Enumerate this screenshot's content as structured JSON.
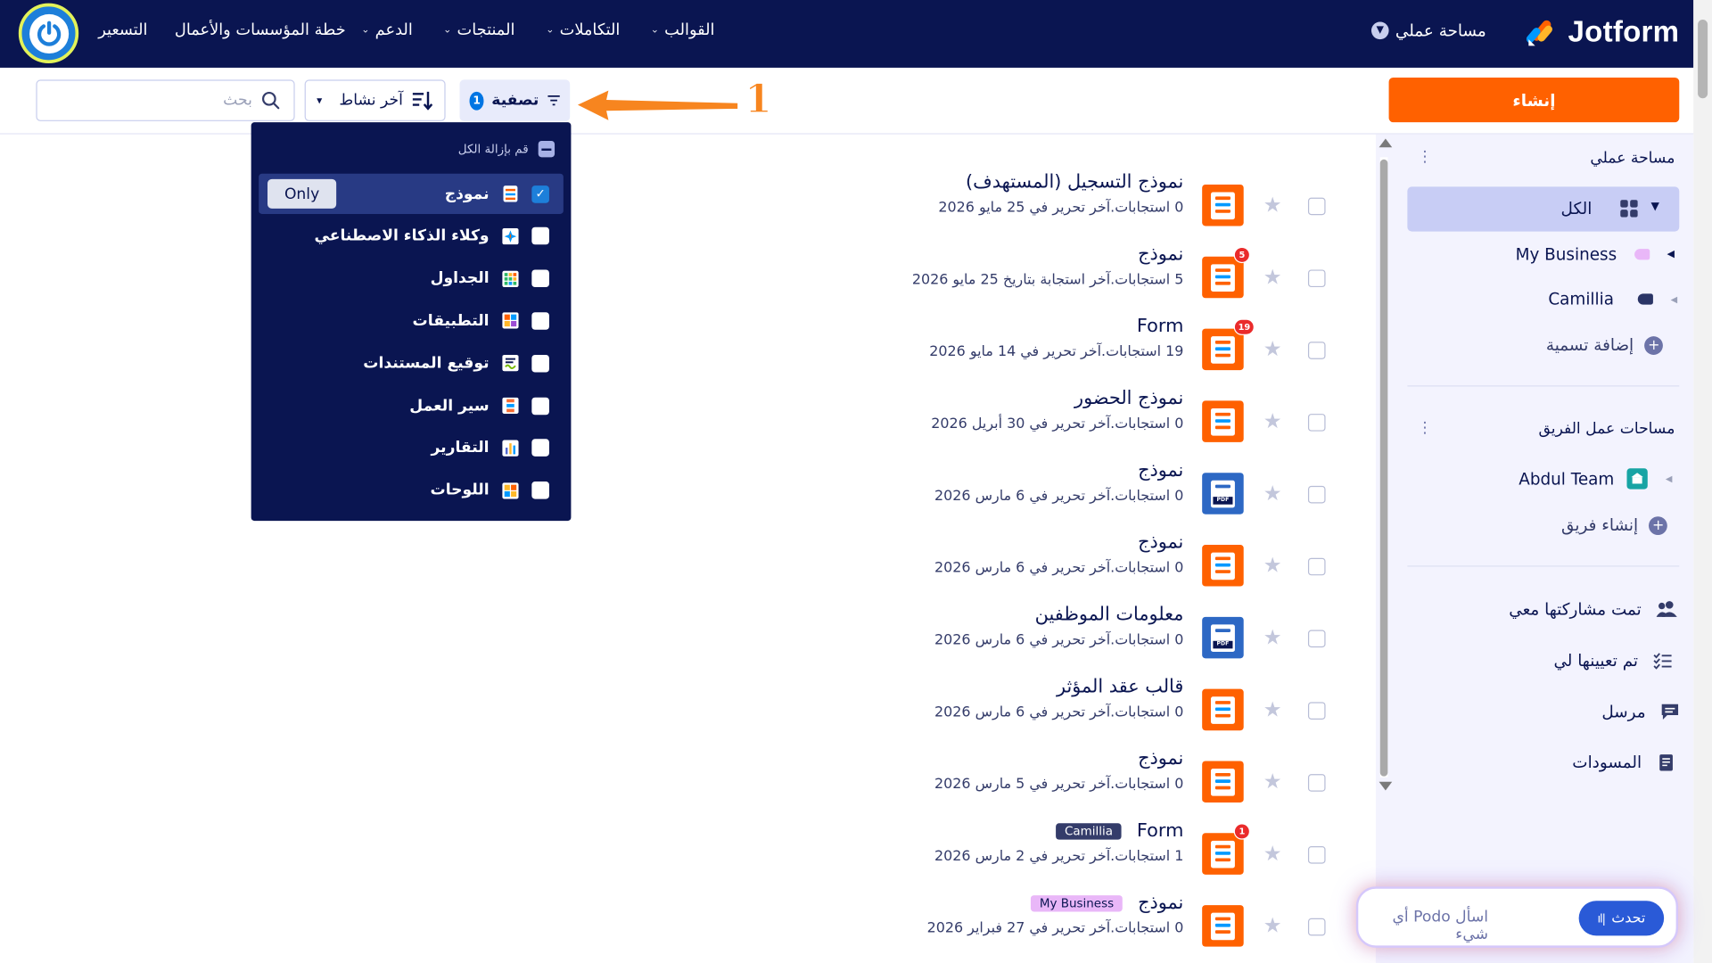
{
  "topbar": {
    "brand": "Jotform",
    "workspace_selector": "مساحة عملي",
    "nav": [
      {
        "label": "القوالب"
      },
      {
        "label": "التكاملات"
      },
      {
        "label": "المنتجات"
      },
      {
        "label": "الدعم"
      },
      {
        "label": "خطة المؤسسات والأعمال"
      },
      {
        "label": "التسعير"
      }
    ]
  },
  "toolbar": {
    "create_label": "إنشاء",
    "filter_label": "تصفية",
    "filter_count": "1",
    "sort_label": "آخر نشاط",
    "search_placeholder": "بحث",
    "annotation_number": "1"
  },
  "sidebar": {
    "my_workspace": "مساحة عملي",
    "all": "الكل",
    "labels": [
      {
        "name": "My Business",
        "color": "#e9b7f8"
      },
      {
        "name": "Camillia",
        "color": "#2a3466"
      }
    ],
    "add_label": "إضافة تسمية",
    "team_workspaces": "مساحات عمل الفريق",
    "team": "Abdul Team",
    "create_team": "إنشاء فريق",
    "shared": "تمت مشاركتها معي",
    "assigned": "تم تعيينها لي",
    "sent": "مرسل",
    "drafts": "المسودات"
  },
  "filter_dropdown": {
    "clear_all": "قم بإزالة الكل",
    "only_label": "Only",
    "items": [
      {
        "label": "نموذج",
        "checked": true,
        "icon": "form-icon",
        "color": "#ff6100"
      },
      {
        "label": "وكلاء الذكاء الاصطناعي",
        "checked": false,
        "icon": "ai-agent-icon",
        "color": "#0099ff"
      },
      {
        "label": "الجداول",
        "checked": false,
        "icon": "tables-icon",
        "color": "#2db966"
      },
      {
        "label": "التطبيقات",
        "checked": false,
        "icon": "apps-icon",
        "color": "#9c4dd3"
      },
      {
        "label": "توقيع المستندات",
        "checked": false,
        "icon": "sign-icon",
        "color": "#78bb07"
      },
      {
        "label": "سير العمل",
        "checked": false,
        "icon": "workflow-icon",
        "color": "#f76c33"
      },
      {
        "label": "التقارير",
        "checked": false,
        "icon": "reports-icon",
        "color": "#5369d0"
      },
      {
        "label": "اللوحات",
        "checked": false,
        "icon": "boards-icon",
        "color": "#fdb829"
      }
    ]
  },
  "forms": [
    {
      "title": "نموذج التسجيل (المستهدف)",
      "meta": "0 استجابات.آخر تحرير في 25 مايو 2026",
      "badge": "",
      "tag": "",
      "type": "form"
    },
    {
      "title": "نموذج",
      "meta": "5 استجابات.آخر استجابة بتاريخ 25 مايو 2026",
      "badge": "5",
      "tag": "",
      "type": "form"
    },
    {
      "title": "Form",
      "meta": "19 استجابات.آخر تحرير في 14 مايو 2026",
      "badge": "19",
      "tag": "",
      "type": "form"
    },
    {
      "title": "نموذج الحضور",
      "meta": "0 استجابات.آخر تحرير في 30 أبريل 2026",
      "badge": "",
      "tag": "",
      "type": "form"
    },
    {
      "title": "نموذج",
      "meta": "0 استجابات.آخر تحرير في 6 مارس 2026",
      "badge": "",
      "tag": "",
      "type": "pdf"
    },
    {
      "title": "نموذج",
      "meta": "0 استجابات.آخر تحرير في 6 مارس 2026",
      "badge": "",
      "tag": "",
      "type": "form"
    },
    {
      "title": "معلومات الموظفين",
      "meta": "0 استجابات.آخر تحرير في 6 مارس 2026",
      "badge": "",
      "tag": "",
      "type": "pdf"
    },
    {
      "title": "قالب عقد المؤثر",
      "meta": "0 استجابات.آخر تحرير في 6 مارس 2026",
      "badge": "",
      "tag": "",
      "type": "form"
    },
    {
      "title": "نموذج",
      "meta": "0 استجابات.آخر تحرير في 5 مارس 2026",
      "badge": "",
      "tag": "",
      "type": "form"
    },
    {
      "title": "Form",
      "meta": "1 استجابات.آخر تحرير في 2 مارس 2026",
      "badge": "1",
      "tag": "Camillia",
      "tag_bg": "#343c6a",
      "tag_fg": "#ffffff",
      "type": "form"
    },
    {
      "title": "نموذج",
      "meta": "0 استجابات.آخر تحرير في 27 فبراير 2026",
      "badge": "",
      "tag": "My Business",
      "tag_bg": "#e9b7f8",
      "tag_fg": "#0a1551",
      "type": "form"
    }
  ],
  "podo": {
    "placeholder": "اسأل Podo أي شيء",
    "talk_label": "تحدث"
  },
  "colors": {
    "navy": "#0a1551",
    "orange": "#ff6100",
    "blue": "#0075e3",
    "sidebar_bg": "#f3f3fe"
  }
}
